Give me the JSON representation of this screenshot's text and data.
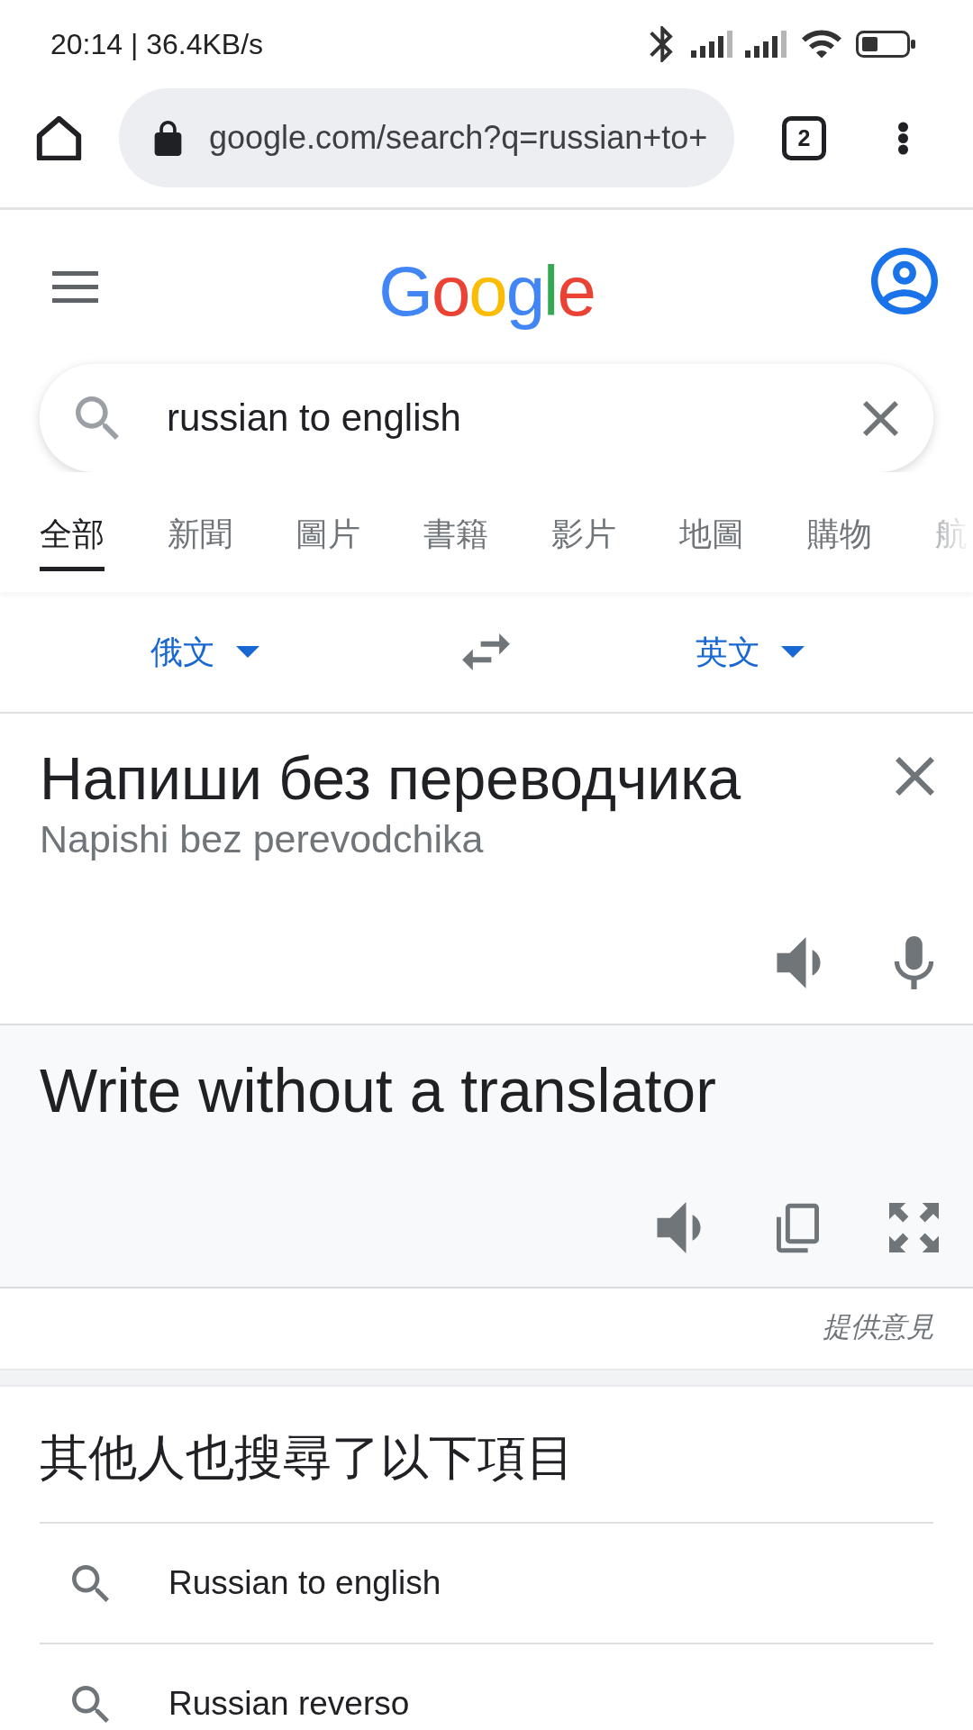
{
  "status_bar": {
    "text": "20:14 | 36.4KB/s"
  },
  "browser": {
    "url": "google.com/search?q=russian+to+",
    "tab_count": "2"
  },
  "header": {
    "logo": "Google"
  },
  "search": {
    "query": "russian to english"
  },
  "tabs": [
    {
      "label": "全部",
      "selected": true
    },
    {
      "label": "新聞",
      "selected": false
    },
    {
      "label": "圖片",
      "selected": false
    },
    {
      "label": "書籍",
      "selected": false
    },
    {
      "label": "影片",
      "selected": false
    },
    {
      "label": "地圖",
      "selected": false
    },
    {
      "label": "購物",
      "selected": false
    },
    {
      "label": "航",
      "selected": false
    }
  ],
  "translator": {
    "source_language": "俄文",
    "target_language": "英文",
    "source_text": "Напиши без переводчика",
    "transliteration": "Napishi bez perevodchika",
    "translation": "Write without a translator",
    "feedback": "提供意見"
  },
  "related": {
    "title": "其他人也搜尋了以下項目",
    "items": [
      {
        "text": "Russian to english"
      },
      {
        "text": "Russian reverso"
      }
    ]
  }
}
